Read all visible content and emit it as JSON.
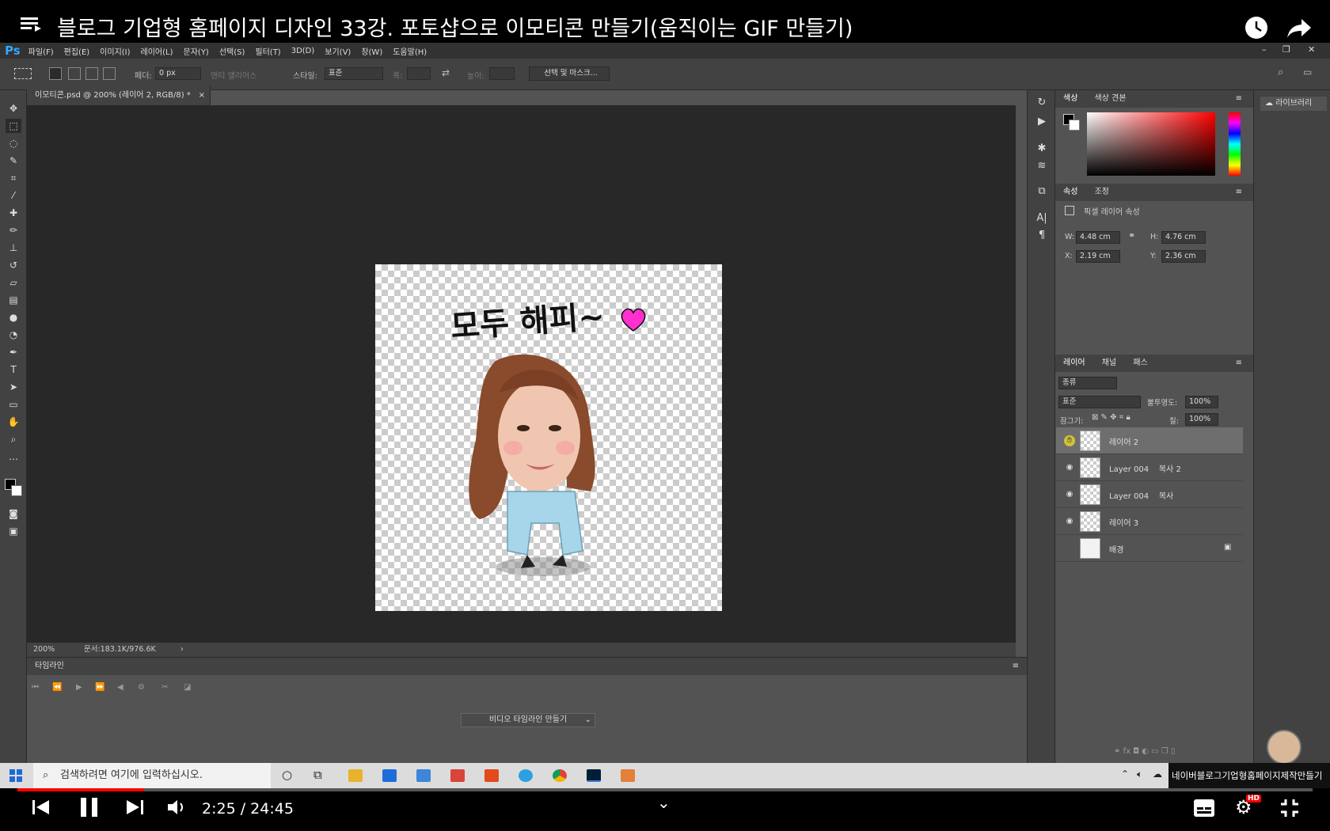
{
  "video": {
    "title": "블로그 기업형 홈페이지 디자인 33강. 포토샵으로 이모티콘 만들기(움직이는 GIF 만들기)",
    "time": "2:25 / 24:45",
    "progress": 0.098,
    "channel_notice": "네이버블로그기업형홈페이지제작만들기"
  },
  "ps": {
    "menu": [
      "파일(F)",
      "편집(E)",
      "이미지(I)",
      "레이어(L)",
      "문자(Y)",
      "선택(S)",
      "필터(T)",
      "3D(D)",
      "보기(V)",
      "창(W)",
      "도움말(H)"
    ],
    "options": {
      "feather_label": "페더:",
      "feather_value": "0 px",
      "antialias": "앤티 앨리어스",
      "style_label": "스타일:",
      "style_value": "표준",
      "width_label": "폭:",
      "height_label": "높이:",
      "select_mask": "선택 및 마스크..."
    },
    "doc_tab": "이모티콘.psd @ 200% (레이어 2, RGB/8) *",
    "canvas_text": "모두 해피~",
    "status_zoom": "200%",
    "status_doc": "문서:183.1K/976.6K",
    "timeline_title": "타임라인",
    "timeline_button": "비디오 타임라인 만들기",
    "color_tabs": [
      "색상",
      "색상 견본"
    ],
    "props_tabs": [
      "속성",
      "조정"
    ],
    "props_title": "픽셀 레이어 속성",
    "props": {
      "w_label": "W:",
      "w": "4.48 cm",
      "h_label": "H:",
      "h": "4.76 cm",
      "x_label": "X:",
      "x": "2.19 cm",
      "y_label": "Y:",
      "y": "2.36 cm"
    },
    "layers_tabs": [
      "레이어",
      "채널",
      "패스"
    ],
    "layer_filter": "종류",
    "blend_mode": "표준",
    "opacity_label": "불투명도:",
    "opacity": "100%",
    "lock_label": "잠그기:",
    "fill_label": "칠:",
    "fill": "100%",
    "layers": [
      {
        "name": "레이어 2",
        "visible": true,
        "selected": true
      },
      {
        "name": "Layer 004    복사 2",
        "visible": true,
        "selected": false
      },
      {
        "name": "Layer 004    복사",
        "visible": true,
        "selected": false
      },
      {
        "name": "레이어 3",
        "visible": true,
        "selected": false
      },
      {
        "name": "배경",
        "visible": false,
        "selected": false
      }
    ],
    "library_label": "라이브러리"
  },
  "taskbar": {
    "search_placeholder": "검색하려면 여기에 입력하십시오."
  },
  "colors": {
    "accent": "#31a8ff",
    "youtube_red": "#ff0000",
    "brush_pink": "#ff2fd0"
  }
}
